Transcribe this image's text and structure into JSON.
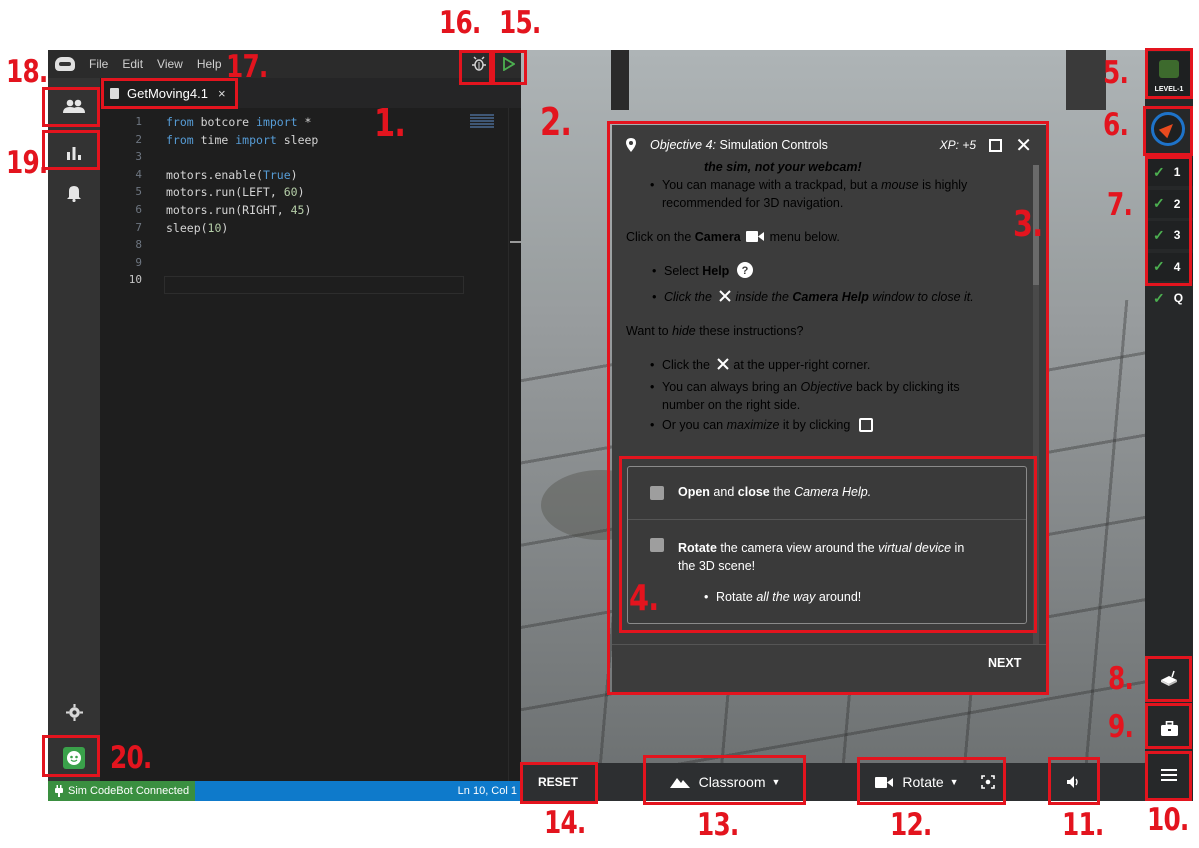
{
  "menu": {
    "items": [
      "File",
      "Edit",
      "View",
      "Help"
    ]
  },
  "editor": {
    "tab_label": "GetMoving4.1",
    "tab_close": "×",
    "lines": [
      {
        "n": "1",
        "code": [
          [
            "kw",
            "from"
          ],
          [
            "t",
            " botcore "
          ],
          [
            "kw",
            "import"
          ],
          [
            "t",
            " *"
          ]
        ]
      },
      {
        "n": "2",
        "code": [
          [
            "kw",
            "from"
          ],
          [
            "t",
            " time "
          ],
          [
            "kw",
            "import"
          ],
          [
            "t",
            " sleep"
          ]
        ]
      },
      {
        "n": "3",
        "code": []
      },
      {
        "n": "4",
        "code": [
          [
            "t",
            "motors.enable("
          ],
          [
            "kw",
            "True"
          ],
          [
            "t",
            ")"
          ]
        ]
      },
      {
        "n": "5",
        "code": [
          [
            "t",
            "motors.run(LEFT, "
          ],
          [
            "num",
            "60"
          ],
          [
            "t",
            ")"
          ]
        ]
      },
      {
        "n": "6",
        "code": [
          [
            "t",
            "motors.run(RIGHT, "
          ],
          [
            "num",
            "45"
          ],
          [
            "t",
            ")"
          ]
        ]
      },
      {
        "n": "7",
        "code": [
          [
            "t",
            "sleep("
          ],
          [
            "num",
            "10"
          ],
          [
            "t",
            ")"
          ]
        ]
      },
      {
        "n": "8",
        "code": []
      },
      {
        "n": "9",
        "code": []
      },
      {
        "n": "10",
        "code": []
      }
    ],
    "current_line": "10"
  },
  "statusbar": {
    "connection": "Sim CodeBot Connected",
    "position": "Ln 10, Col 1"
  },
  "objective": {
    "title_prefix": "Objective 4:",
    "title": "Simulation Controls",
    "xp": "XP: +5",
    "close": "✕",
    "text": {
      "cut_line": "the sim, not your webcam!",
      "b1a": "You can manage with a trackpad, but a ",
      "b1b": "mouse",
      "b1c": " is highly",
      "b1d": "recommended for 3D navigation.",
      "camera_a": "Click on the ",
      "camera_b": "Camera",
      "camera_c": " menu below.",
      "sel_a": "Select ",
      "sel_b": "Help",
      "click_a": "Click the",
      "click_b": "inside the ",
      "click_c": "Camera Help",
      "click_d": " window to close it.",
      "hide_a": "Want to ",
      "hide_b": "hide",
      "hide_c": " these instructions?",
      "h1a": "Click the",
      "h1b": "at the upper-right corner.",
      "h2a": "You can always bring an ",
      "h2b": "Objective",
      "h2c": " back by clicking its",
      "h2d": "number on the right side.",
      "h3a": "Or you can ",
      "h3b": "maximize",
      "h3c": " it by clicking"
    },
    "tasks": {
      "t1a": "Open",
      "t1b": " and ",
      "t1c": "close",
      "t1d": " the ",
      "t1e": "Camera Help.",
      "t2a": "Rotate",
      "t2b": " the camera view around the ",
      "t2c": "virtual device",
      "t2d": " in",
      "t2e": "the 3D scene!",
      "t3a": "Rotate ",
      "t3b": "all the way",
      "t3c": " around!"
    },
    "next": "NEXT"
  },
  "simbar": {
    "reset": "RESET",
    "environment": "Classroom",
    "camera": "Rotate"
  },
  "level": {
    "label": "LEVEL-1"
  },
  "objectives_list": [
    {
      "label": "1",
      "done": true
    },
    {
      "label": "2",
      "done": true
    },
    {
      "label": "3",
      "done": true
    },
    {
      "label": "4",
      "done": true
    },
    {
      "label": "Q",
      "done": true
    }
  ],
  "annotations": [
    "1.",
    "2.",
    "3.",
    "4.",
    "5.",
    "6.",
    "7.",
    "8.",
    "9.",
    "10.",
    "11.",
    "12.",
    "13.",
    "14.",
    "15.",
    "16.",
    "17.",
    "18.",
    "19.",
    "20."
  ],
  "colors": {
    "annotation": "#e3141e",
    "accent_blue": "#0e7acb",
    "check_green": "#4caf50"
  }
}
